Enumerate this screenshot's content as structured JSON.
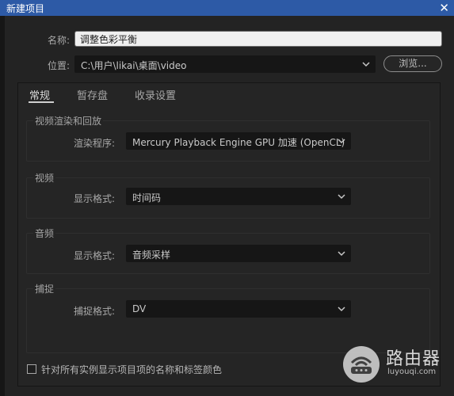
{
  "window": {
    "title": "新建项目",
    "close_glyph": "✕"
  },
  "form": {
    "name_label": "名称:",
    "name_value": "调整色彩平衡",
    "location_label": "位置:",
    "location_value": "C:\\用户\\likai\\桌面\\video",
    "browse_label": "浏览..."
  },
  "tabs": [
    {
      "label": "常规",
      "active": true
    },
    {
      "label": "暂存盘",
      "active": false
    },
    {
      "label": "收录设置",
      "active": false
    }
  ],
  "groups": {
    "render": {
      "title": "视频渲染和回放",
      "field_label": "渲染程序:",
      "field_value": "Mercury Playback Engine GPU 加速 (OpenCL)"
    },
    "video": {
      "title": "视频",
      "field_label": "显示格式:",
      "field_value": "时间码"
    },
    "audio": {
      "title": "音频",
      "field_label": "显示格式:",
      "field_value": "音频采样"
    },
    "capture": {
      "title": "捕捉",
      "field_label": "捕捉格式:",
      "field_value": "DV"
    }
  },
  "option": {
    "checked": false,
    "label": "针对所有实例显示项目项的名称和标签颜色"
  },
  "watermark": {
    "name": "路由器",
    "site": "luyouqi.com"
  },
  "icons": [
    "close-icon",
    "chevron-down-icon",
    "router-logo-icon"
  ],
  "colors": {
    "titlebar": "#2d5aa6",
    "background": "#232323",
    "field": "#161616"
  }
}
